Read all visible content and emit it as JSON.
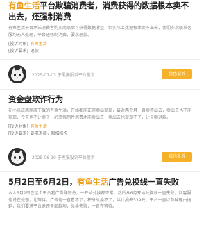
{
  "posts": [
    {
      "title_brand": "有鱼生活",
      "title_rest": "平台欺骗消费者，消费获得的数据根本卖不出去，还强制消费",
      "body": "有鱼生活平台承诺消费者购买商品后可获得数据收益，但实际上数据根本卖不出去，我们多次联系客服均无人处理，平台还强制消费，要求退款。",
      "complaint_label": "[投诉对象]",
      "complaint_value": "有鱼生活",
      "demand_label": "[投诉要求]",
      "demand_value": "退款"
    },
    {
      "title_brand": "",
      "title_rest": "资金盘欺诈行为",
      "body": "在小米应用商店下载的有鱼生活，开始都能正常卖出提现，最近两个月一直卖不出去，卖出去也不能提现，今天也不让卖了，必须强制性消费才能卖出去，卖出去也提现不了，让全额退款。",
      "complaint_label": "[投诉对象]",
      "complaint_value": "有鱼生活",
      "demand_label": "[投诉要求]",
      "demand_value": "要求退款，赔偿损失"
    },
    {
      "title_pre": "5月2日至6月2日，",
      "title_brand": "有鱼生活",
      "title_rest": "广告兑换线一直失败",
      "body": "本人5月2日在这个平台看广告赚积分，一开始兑换都正常，然后从6月开始兑换就一直失败，问客服也说在处理，让等待，广告也一直看不了，积分兑换不了，共计损失539元，平台一直以各种理由拖延，我们要求平台退还全部款项，兑换失败，一直在等待。"
    }
  ],
  "authors": [
    {
      "time": "2025-07-03 于黑猫投诉平台投诉",
      "button": "我也投诉"
    },
    {
      "time": "2025-06-10 于黑猫投诉平台投诉",
      "button": "我也投诉"
    }
  ],
  "colors": {
    "brand": "#f0a020",
    "button": "#f5b12a"
  },
  "icons": [
    "cat-avatar-icon"
  ]
}
